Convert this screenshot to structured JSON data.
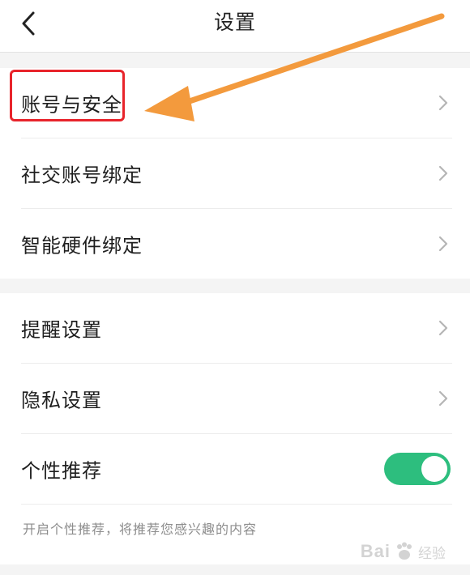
{
  "header": {
    "title": "设置"
  },
  "group1": {
    "items": [
      {
        "label": "账号与安全"
      },
      {
        "label": "社交账号绑定"
      },
      {
        "label": "智能硬件绑定"
      }
    ]
  },
  "group2": {
    "items": [
      {
        "label": "提醒设置"
      },
      {
        "label": "隐私设置"
      },
      {
        "label": "个性推荐"
      }
    ],
    "recommend_enabled": true,
    "note": "开启个性推荐，将推荐您感兴趣的内容"
  },
  "colors": {
    "toggle_on": "#2dbe7e",
    "highlight": "#e8242b",
    "arrow": "#f39a3d"
  },
  "watermark": {
    "brand": "Bai",
    "brand_tail": "经验"
  }
}
